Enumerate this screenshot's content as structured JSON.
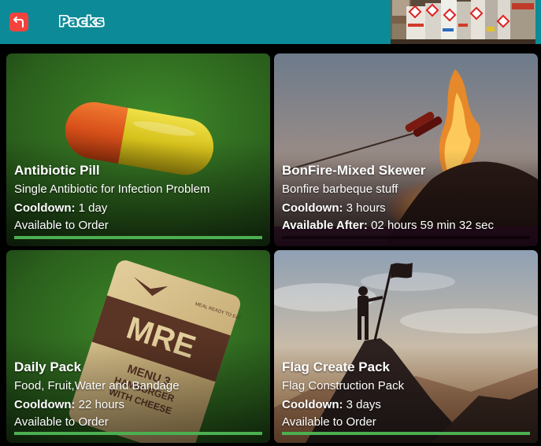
{
  "header": {
    "title": "Packs",
    "back_icon": "back-arrow-icon",
    "colors": {
      "bar": "#0c8a97",
      "back_button": "#f4433d"
    }
  },
  "cards": [
    {
      "name": "Antibiotic Pill",
      "description": "Single Antibiotic for Infection Problem",
      "meta_label": "Cooldown:",
      "meta_value": " 1 day",
      "status": "Available to Order",
      "progress": 1.0
    },
    {
      "name": "BonFire-Mixed Skewer",
      "description": "Bonfire barbeque stuff",
      "meta_label": "Cooldown:",
      "meta_value": " 3 hours",
      "status_label": "Available After:",
      "status_value": " 02 hours 59 min 32 sec",
      "progress": 0.0
    },
    {
      "name": "Daily Pack",
      "description": "Food, Fruit,Water and Bandage",
      "meta_label": "Cooldown:",
      "meta_value": " 22 hours",
      "status": "Available to Order",
      "progress": 1.0
    },
    {
      "name": "Flag Create Pack",
      "description": "Flag Construction Pack",
      "meta_label": "Cooldown:",
      "meta_value": " 3 days",
      "status": "Available to Order",
      "progress": 1.0
    }
  ],
  "colors": {
    "progress": "#4caf50"
  }
}
